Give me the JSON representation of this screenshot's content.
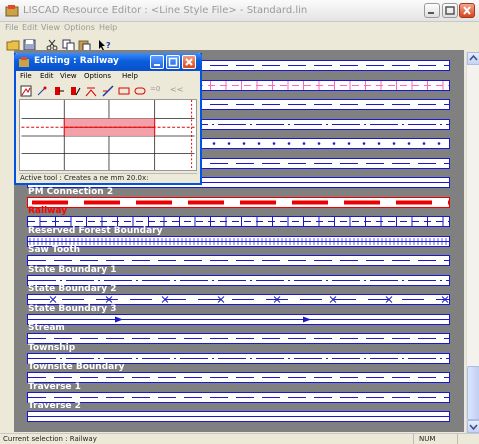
{
  "window": {
    "title": "LISCAD Resource Editor : <Line Style File> - Standard.lin"
  },
  "menubar": {
    "items": [
      "File",
      "Edit",
      "View",
      "Options",
      "Help"
    ]
  },
  "toolbar": {
    "icons": [
      "open-folder-icon",
      "save-icon",
      "cut-icon",
      "copy-icon",
      "paste-icon",
      "context-help-icon"
    ]
  },
  "line_styles": [
    {
      "label": "",
      "pattern": "dash-gap",
      "color": "#1a1acc",
      "selected": false
    },
    {
      "label": "",
      "pattern": "dash-cross",
      "color": "#ff69b4",
      "selected": false
    },
    {
      "label": "",
      "pattern": "dash-gap",
      "color": "#1a1acc",
      "selected": false
    },
    {
      "label": "",
      "pattern": "long-dash-dot",
      "color": "#1a1acc",
      "selected": false
    },
    {
      "label": "",
      "pattern": "dots",
      "color": "#1a1acc",
      "selected": false
    },
    {
      "label": "",
      "pattern": "dash-gap",
      "color": "#1a1acc",
      "selected": false
    },
    {
      "label": "",
      "pattern": "solid",
      "color": "#1a1acc",
      "selected": false
    },
    {
      "label": "PM Connection 2",
      "pattern": "red-bars",
      "color": "#ee0000",
      "selected": false
    },
    {
      "label": "Railway",
      "pattern": "dash-cross",
      "color": "#1a1acc",
      "selected": true
    },
    {
      "label": "Reserved Forest Boundary",
      "pattern": "dense-cross",
      "color": "#1a1acc",
      "selected": false
    },
    {
      "label": "Saw Tooth",
      "pattern": "dash-gap",
      "color": "#1a1acc",
      "selected": false
    },
    {
      "label": "State Boundary 1",
      "pattern": "long-dash-dot",
      "color": "#1a1acc",
      "selected": false
    },
    {
      "label": "State Boundary 2",
      "pattern": "dash-x",
      "color": "#1a1acc",
      "selected": false
    },
    {
      "label": "State Boundary 3",
      "pattern": "solid-arrow",
      "color": "#1a1acc",
      "selected": false
    },
    {
      "label": "Stream",
      "pattern": "dash-gap",
      "color": "#1a1acc",
      "selected": false
    },
    {
      "label": "Township",
      "pattern": "long-dash-dot",
      "color": "#1a1acc",
      "selected": false
    },
    {
      "label": "Townsite Boundary",
      "pattern": "dash-gap",
      "color": "#1a1acc",
      "selected": false
    },
    {
      "label": "Traverse 1",
      "pattern": "dash-gap",
      "color": "#1a1acc",
      "selected": false
    },
    {
      "label": "Traverse 2",
      "pattern": "solid",
      "color": "#1a1acc",
      "selected": false
    }
  ],
  "editing": {
    "title": "Editing : Railway",
    "menu": [
      "File",
      "Edit",
      "View",
      "Options",
      "Help"
    ],
    "toolbar_icons": [
      "draw-icon",
      "add-point-icon",
      "insert-icon",
      "edit-icon",
      "cross-icon",
      "slash-icon",
      "rectangle-icon",
      "pill-icon",
      "zero-icon",
      "back-icon"
    ],
    "zero_label": "=0",
    "back_label": "<<",
    "status": "Active tool : Creates a ne mm 20.0x:"
  },
  "statusbar": {
    "current_selection": "Current selection : Railway",
    "num": "NUM"
  },
  "colors": {
    "accent": "#0054e3",
    "row_border": "#1a1acc",
    "selected": "#ee0000",
    "background": "#808080"
  }
}
